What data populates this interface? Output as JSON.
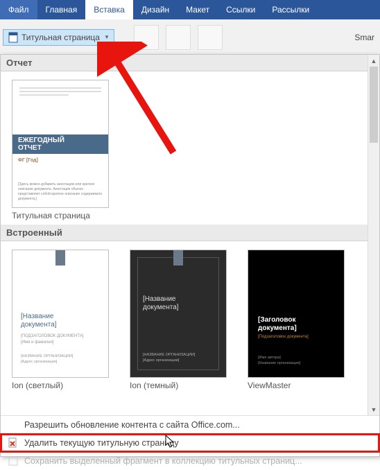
{
  "tabs": {
    "file": "Файл",
    "home": "Главная",
    "insert": "Вставка",
    "design": "Дизайн",
    "layout": "Макет",
    "references": "Ссылки",
    "mailings": "Рассылки"
  },
  "ribbon": {
    "cover_page": "Титульная страница",
    "smartart": "Smar"
  },
  "gallery": {
    "section_report": "Отчет",
    "section_builtin": "Встроенный",
    "templates": {
      "annual": {
        "caption": "Титульная страница",
        "block_line1": "ЕЖЕГОДНЫЙ",
        "block_line2": "ОТЧЕТ",
        "sub": "ФГ [Год]",
        "ft": "[Здесь можно добавить аннотацию или краткое описание документа. Аннотация обычно представляет собой краткое описание содержимого документа.]"
      },
      "ion_light": {
        "caption": "Ion (светлый)",
        "title1": "[Название",
        "title2": "документа]",
        "lines": "[ПОДЗАГОЛОВОК ДОКУМЕНТА]",
        "lines2": "[Имя и фамилия]",
        "ft1": "[НАЗВАНИЕ ОРГАНИЗАЦИИ]",
        "ft2": "[Адрес организации]"
      },
      "ion_dark": {
        "caption": "Ion (темный)",
        "title1": "[Название",
        "title2": "документа]",
        "ft1": "[НАЗВАНИЕ ОРГАНИЗАЦИИ]",
        "ft2": "[Адрес организации]"
      },
      "viewmaster": {
        "caption": "ViewMaster",
        "title1": "[Заголовок",
        "title2": "документа]",
        "sub": "[Подзаголовок документа]",
        "ft1": "[Имя автора]",
        "ft2": "[Название организации]"
      }
    },
    "menu": {
      "office_update": "Разрешить обновление контента с сайта Office.com...",
      "remove_cover": "Удалить текущую титульную страницу",
      "save_selection": "Сохранить выделенный фрагмент в коллекцию титульных страниц..."
    }
  }
}
